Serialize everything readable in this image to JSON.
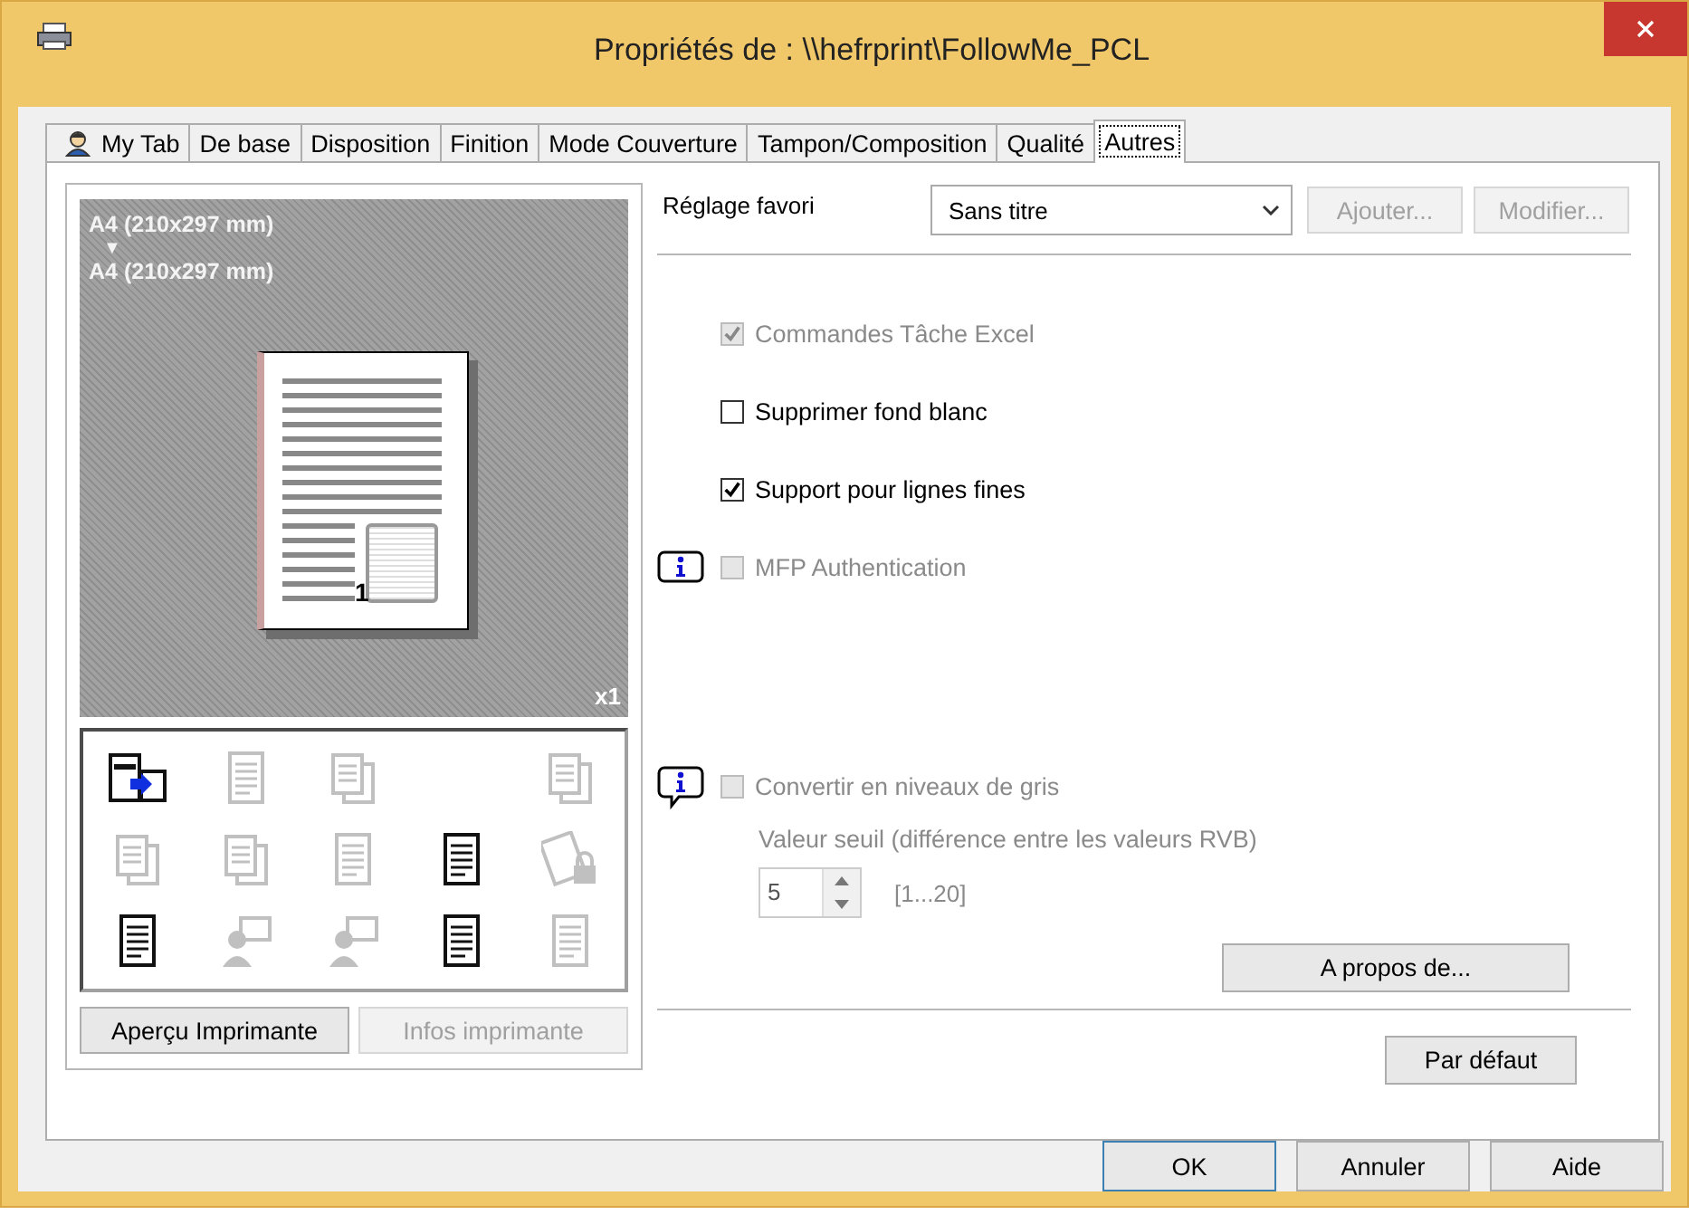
{
  "window": {
    "title": "Propriétés de : \\\\hefrprint\\FollowMe_PCL"
  },
  "tabs": [
    {
      "label": "My Tab",
      "kind": "icon",
      "selected": false
    },
    {
      "label": "De base",
      "kind": "text",
      "selected": false
    },
    {
      "label": "Disposition",
      "kind": "text",
      "selected": false
    },
    {
      "label": "Finition",
      "kind": "text",
      "selected": false
    },
    {
      "label": "Mode Couverture",
      "kind": "text",
      "selected": false
    },
    {
      "label": "Tampon/Composition",
      "kind": "text",
      "selected": false
    },
    {
      "label": "Qualité",
      "kind": "text",
      "selected": false
    },
    {
      "label": "Autres",
      "kind": "text",
      "selected": true
    }
  ],
  "preview": {
    "paper_in": "A4 (210x297 mm)",
    "arrow": "▼",
    "paper_out": "A4 (210x297 mm)",
    "page_number": "1",
    "copies": "x1"
  },
  "function_icons": [
    {
      "kind": "machine",
      "enabled": true
    },
    {
      "kind": "page",
      "enabled": false
    },
    {
      "kind": "stack",
      "enabled": false
    },
    {
      "kind": "blank"
    },
    {
      "kind": "stack",
      "enabled": false
    },
    {
      "kind": "stack",
      "enabled": false
    },
    {
      "kind": "stack",
      "enabled": false
    },
    {
      "kind": "page",
      "enabled": false
    },
    {
      "kind": "page",
      "enabled": true
    },
    {
      "kind": "lock",
      "enabled": false
    },
    {
      "kind": "page",
      "enabled": true
    },
    {
      "kind": "person",
      "enabled": false
    },
    {
      "kind": "person",
      "enabled": false
    },
    {
      "kind": "page",
      "enabled": true
    },
    {
      "kind": "page",
      "enabled": false
    }
  ],
  "preview_buttons": [
    {
      "label": "Aperçu Imprimante",
      "disabled": false
    },
    {
      "label": "Infos imprimante",
      "disabled": true
    }
  ],
  "favorite": {
    "label": "Réglage favori",
    "value": "Sans titre",
    "buttons": [
      {
        "label": "Ajouter...",
        "disabled": true
      },
      {
        "label": "Modifier...",
        "disabled": true
      }
    ]
  },
  "options": [
    {
      "label": "Commandes Tâche Excel",
      "checked": true,
      "disabled": true,
      "info": false
    },
    {
      "label": "Supprimer fond blanc",
      "checked": false,
      "disabled": false,
      "info": false
    },
    {
      "label": "Support pour lignes fines",
      "checked": true,
      "disabled": false,
      "info": false
    },
    {
      "label": "MFP Authentication",
      "checked": false,
      "disabled": true,
      "info": true
    }
  ],
  "grayscale": {
    "label": "Convertir en niveaux de gris",
    "checked": false,
    "disabled": true,
    "info": true,
    "threshold_label": "Valeur seuil (différence entre les valeurs RVB)",
    "value": "5",
    "range": "[1...20]"
  },
  "about_button": "A propos de...",
  "default_button": "Par défaut",
  "dialog_buttons": [
    {
      "label": "OK",
      "default": true
    },
    {
      "label": "Annuler",
      "default": false
    },
    {
      "label": "Aide",
      "default": false
    }
  ]
}
